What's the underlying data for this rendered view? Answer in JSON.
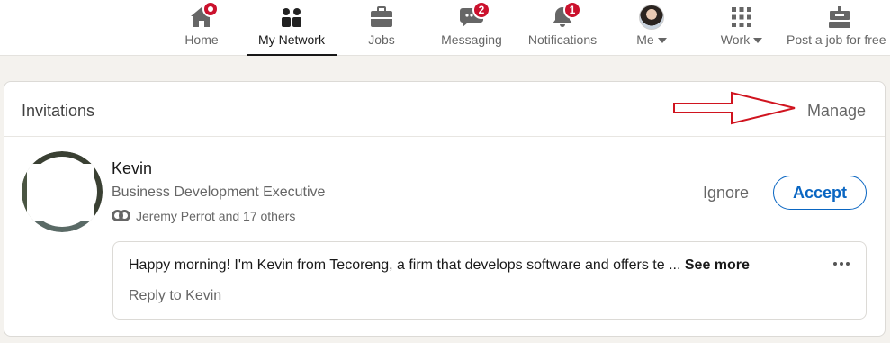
{
  "nav": {
    "home_label": "Home",
    "network_label": "My Network",
    "jobs_label": "Jobs",
    "messaging_label": "Messaging",
    "messaging_badge": "2",
    "notifications_label": "Notifications",
    "notifications_badge": "1",
    "me_label": "Me",
    "work_label": "Work",
    "post_job_label": "Post a job for free"
  },
  "invitations": {
    "title": "Invitations",
    "manage_label": "Manage",
    "items": [
      {
        "name": "Kevin",
        "headline": "Business Development Executive",
        "mutual": "Jeremy Perrot and 17 others",
        "ignore_label": "Ignore",
        "accept_label": "Accept",
        "message": "Happy morning! I'm Kevin from Tecoreng, a firm that develops software and offers te ...",
        "see_more_label": "See more",
        "reply_label": "Reply to Kevin"
      }
    ]
  },
  "colors": {
    "accent": "#0a66c2",
    "badge": "#cb112d",
    "annotation_arrow": "#d0141f"
  }
}
